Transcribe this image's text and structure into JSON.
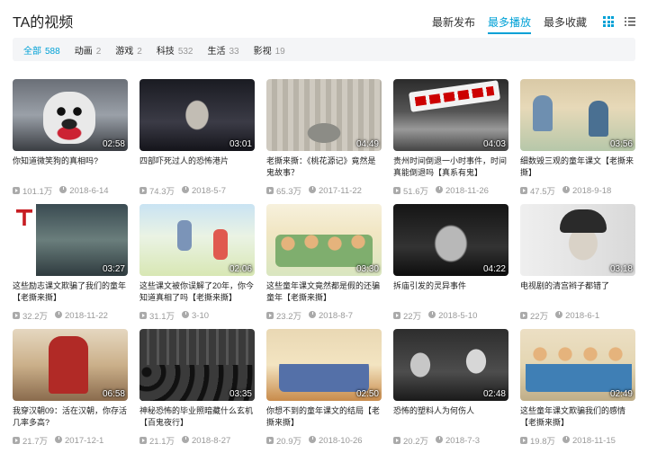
{
  "header": {
    "title": "TA的视频",
    "sort_tabs": [
      {
        "label": "最新发布",
        "active": false
      },
      {
        "label": "最多播放",
        "active": true
      },
      {
        "label": "最多收藏",
        "active": false
      }
    ],
    "view_modes": {
      "grid_icon": "grid-icon",
      "list_icon": "list-icon",
      "active": "grid"
    }
  },
  "filters": [
    {
      "label": "全部",
      "count": "588",
      "active": true
    },
    {
      "label": "动画",
      "count": "2",
      "active": false
    },
    {
      "label": "游戏",
      "count": "2",
      "active": false
    },
    {
      "label": "科技",
      "count": "532",
      "active": false
    },
    {
      "label": "生活",
      "count": "33",
      "active": false
    },
    {
      "label": "影视",
      "count": "19",
      "active": false
    }
  ],
  "colors": {
    "accent": "#00a1d6",
    "muted": "#999999",
    "filter_bg": "#f4f5f7"
  },
  "videos": [
    {
      "title": "你知道微笑狗的真相吗?",
      "duration": "02:58",
      "plays": "101.1万",
      "date": "2018-6-14"
    },
    {
      "title": "四部吓死过人的恐怖港片",
      "duration": "03:01",
      "plays": "74.3万",
      "date": "2018-5-7"
    },
    {
      "title": "老撕来撕：《桃花源记》竟然是鬼故事？",
      "duration": "04:49",
      "plays": "65.3万",
      "date": "2017-11-22"
    },
    {
      "title": "贵州时间倒退一小时事件，时间真能倒退吗【真系有鬼】",
      "duration": "04:03",
      "plays": "51.6万",
      "date": "2018-11-26"
    },
    {
      "title": "细数毁三观的童年课文【老撕来撕】",
      "duration": "03:56",
      "plays": "47.5万",
      "date": "2018-9-18"
    },
    {
      "title": "这些励志课文欺骗了我们的童年【老撕来撕】",
      "duration": "03:27",
      "plays": "32.2万",
      "date": "2018-11-22"
    },
    {
      "title": "这些课文被你误解了20年，你今知道真相了吗【老撕来撕】",
      "duration": "02:06",
      "plays": "31.1万",
      "date": "3-10"
    },
    {
      "title": "这些童年课文竟然都是假的还骗童年【老撕来撕】",
      "duration": "03:30",
      "plays": "23.2万",
      "date": "2018-8-7"
    },
    {
      "title": "拆庙引发的灵异事件",
      "duration": "04:22",
      "plays": "22万",
      "date": "2018-5-10"
    },
    {
      "title": "电视剧的清宫辫子都错了",
      "duration": "03:18",
      "plays": "22万",
      "date": "2018-6-1"
    },
    {
      "title": "我穿汉朝09：活在汉朝，你存活几率多高?",
      "duration": "06:58",
      "plays": "21.7万",
      "date": "2017-12-1"
    },
    {
      "title": "神秘恐怖的毕业照暗藏什么玄机【百鬼夜行】",
      "duration": "03:35",
      "plays": "21.1万",
      "date": "2018-8-27"
    },
    {
      "title": "你想不到的童年课文的结局【老撕来撕】",
      "duration": "02:50",
      "plays": "20.9万",
      "date": "2018-10-26"
    },
    {
      "title": "恐怖的塑料人为何伤人",
      "duration": "02:48",
      "plays": "20.2万",
      "date": "2018-7-3"
    },
    {
      "title": "这些童年课文欺骗我们的感情【老撕来撕】",
      "duration": "02:49",
      "plays": "19.8万",
      "date": "2018-11-15"
    }
  ]
}
